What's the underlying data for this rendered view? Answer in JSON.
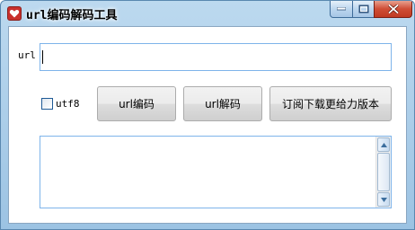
{
  "window": {
    "title": "url编码解码工具",
    "icon": "heart-app-icon",
    "controls": [
      "minimize-icon",
      "maximize-icon",
      "close-icon"
    ]
  },
  "form": {
    "url_label": "url",
    "url_value": "",
    "utf8_label": "utf8",
    "utf8_checked": false
  },
  "buttons": {
    "encode": "url编码",
    "decode": "url解码",
    "upgrade": "订阅下载更给力版本"
  },
  "output": {
    "value": ""
  },
  "colors": {
    "title_bar": "#bcd9ef",
    "close_button": "#c9432b",
    "input_border": "#7eb4ea",
    "app_icon": "#c9302c"
  }
}
